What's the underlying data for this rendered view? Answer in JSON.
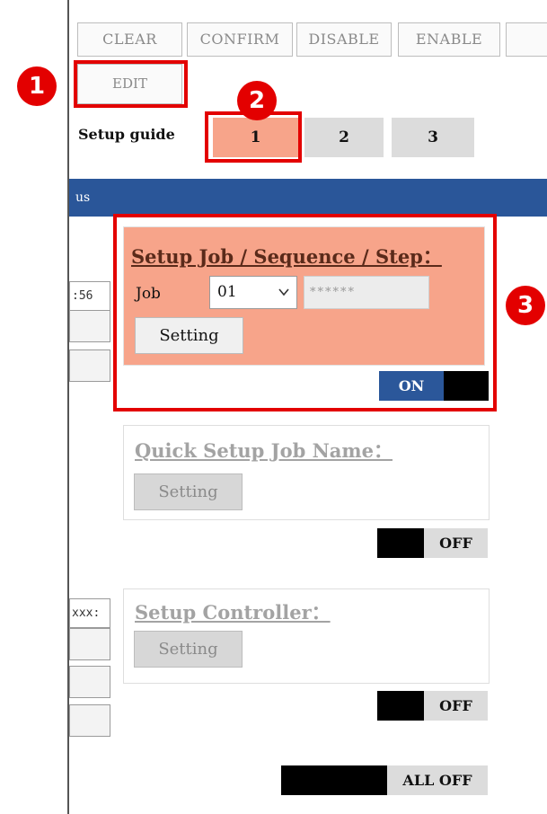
{
  "toolbar": {
    "clear_label": "CLEAR",
    "confirm_label": "CONFIRM",
    "disable_label": "DISABLE",
    "enable_label": "ENABLE",
    "edit_label": "EDIT"
  },
  "setup_guide": {
    "label": "Setup guide",
    "steps": [
      "1",
      "2",
      "3"
    ]
  },
  "status_bar": {
    "text": "us"
  },
  "left_panel": {
    "top_value": ":56",
    "mid_value": "xxx:"
  },
  "sections": {
    "job": {
      "title": "Setup Job / Sequence / Step：",
      "job_label": "Job",
      "job_value": "01",
      "job_name": "******",
      "setting_label": "Setting",
      "toggle_label": "ON"
    },
    "quick": {
      "title": "Quick Setup Job Name：",
      "setting_label": "Setting",
      "toggle_label": "OFF"
    },
    "controller": {
      "title": "Setup Controller：",
      "setting_label": "Setting",
      "toggle_label": "OFF"
    }
  },
  "all_off_label": "ALL OFF",
  "markers": [
    "1",
    "2",
    "3"
  ],
  "colors": {
    "highlight": "#f7a48a",
    "status_blue": "#2a5699",
    "annotation_red": "#e30000"
  }
}
